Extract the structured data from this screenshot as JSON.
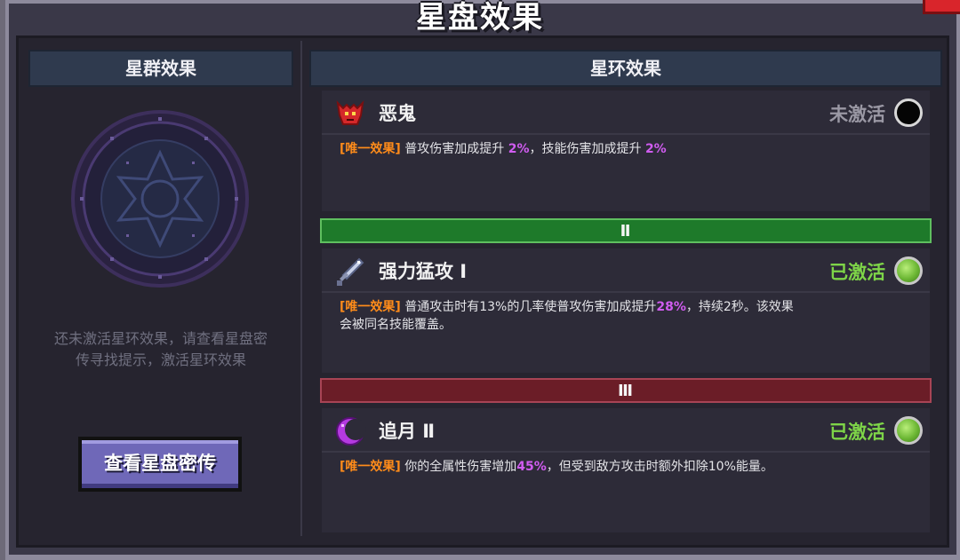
{
  "window": {
    "title": "星盘效果"
  },
  "left": {
    "header": "星群效果",
    "hint_line1": "还未激活星环效果，请查看星盘密",
    "hint_line2": "传寻找提示，激活星环效果",
    "button": "查看星盘密传"
  },
  "right": {
    "header": "星环效果",
    "cards": [
      {
        "name": "恶鬼",
        "status": "未激活",
        "icon": "demon-icon",
        "tag": "[唯一效果]",
        "desc_a": " 普攻伤害加成提升 ",
        "pct_a": "2%",
        "desc_b": "，技能伤害加成提升 ",
        "pct_b": "2%",
        "desc_c": "",
        "line2": ""
      },
      {
        "name": "强力猛攻 Ⅰ",
        "status": "已激活",
        "icon": "sword-icon",
        "tag": "[唯一效果]",
        "desc_a": " 普通攻击时有13%的几率使普攻伤害加成提升",
        "pct_a": "28%",
        "desc_b": "，持续2秒。该效果",
        "pct_b": "",
        "desc_c": "",
        "line2": "会被同名技能覆盖。"
      },
      {
        "name": "追月 Ⅱ",
        "status": "已激活",
        "icon": "crescent-moon-icon",
        "tag": "[唯一效果]",
        "desc_a": " 你的全属性伤害增加",
        "pct_a": "45%",
        "desc_b": "，但受到敌方攻击时额外扣除10%能量。",
        "pct_b": "",
        "desc_c": "",
        "line2": ""
      }
    ],
    "banners": [
      "Ⅱ",
      "Ⅲ"
    ]
  },
  "colors": {
    "tag": "#ff8c1a",
    "percent": "#d05cf0",
    "active": "#7ed548",
    "inactive": "#9a98a4",
    "tier2": "#1e7a2a",
    "tier3": "#6b1d27"
  }
}
